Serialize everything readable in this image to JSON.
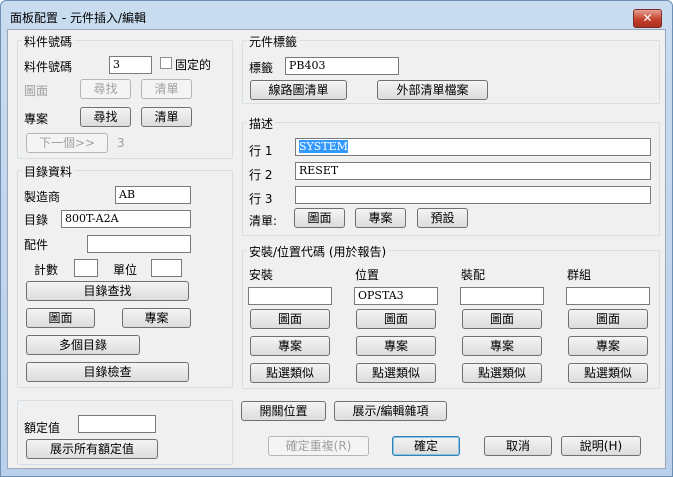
{
  "window": {
    "title": "面板配置 - 元件插入/編輯",
    "close_glyph": "✕"
  },
  "item_number": {
    "group_title": "料件號碼",
    "label": "料件號碼",
    "value": "3",
    "fixed_label": "固定的",
    "drawing_label": "圖面",
    "project_label": "專案",
    "find_label": "尋找",
    "clear_label": "清單",
    "next_label": "下一個>>",
    "next_count": "3"
  },
  "catalog": {
    "group_title": "目錄資料",
    "manufacturer_label": "製造商",
    "manufacturer_value": "AB",
    "catalog_label": "目錄",
    "catalog_value": "800T-A2A",
    "assembly_label": "配件",
    "assembly_value": "",
    "count_label": "計數",
    "count_value": "",
    "unit_label": "單位",
    "unit_value": "",
    "lookup_label": "目錄查找",
    "drawing_label": "圖面",
    "project_label": "專案",
    "multi_label": "多個目錄",
    "check_label": "目錄檢查"
  },
  "rating": {
    "label": "額定值",
    "value": "",
    "show_all_label": "展示所有額定值"
  },
  "tag": {
    "group_title": "元件標籤",
    "label": "標籤",
    "value": "PB403",
    "schematic_list_label": "線路圖清單",
    "external_list_label": "外部清單檔案"
  },
  "description": {
    "group_title": "描述",
    "lines": [
      {
        "label": "行 1",
        "value": "SYSTEM"
      },
      {
        "label": "行 2",
        "value": "RESET"
      },
      {
        "label": "行 3",
        "value": ""
      }
    ],
    "list_label": "清單:",
    "drawing_label": "圖面",
    "project_label": "專案",
    "defaults_label": "預設"
  },
  "location": {
    "group_title": "安裝/位置代碼 (用於報告)",
    "columns": [
      {
        "label": "安裝",
        "value": ""
      },
      {
        "label": "位置",
        "value": "OPSTA3"
      },
      {
        "label": "裝配",
        "value": ""
      },
      {
        "label": "群組",
        "value": ""
      }
    ],
    "drawing_label": "圖面",
    "project_label": "專案",
    "pick_label": "點選類似"
  },
  "footer": {
    "switch_pos_label": "開關位置",
    "show_edit_misc_label": "展示/編輯雜項",
    "ok_repeat_label": "確定重複(R)",
    "ok_label": "確定",
    "cancel_label": "取消",
    "help_label": "說明(H)"
  }
}
